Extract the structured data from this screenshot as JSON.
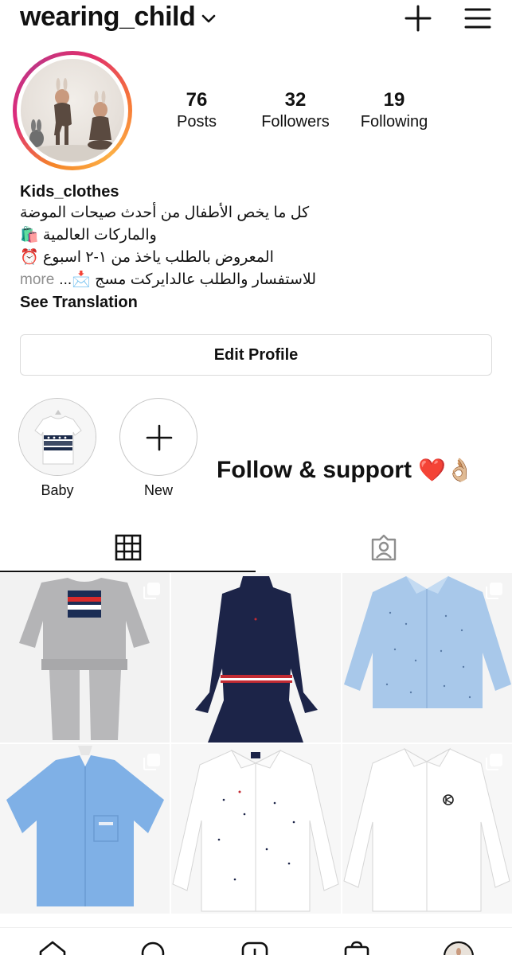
{
  "header": {
    "username": "wearing_child"
  },
  "stats": [
    {
      "value": "76",
      "label": "Posts"
    },
    {
      "value": "32",
      "label": "Followers"
    },
    {
      "value": "19",
      "label": "Following"
    }
  ],
  "bio": {
    "name": "Kids_clothes",
    "line1": "كل ما يخص الأطفال من أحدث صيحات الموضة",
    "line2": "والماركات العالمية 🛍️",
    "line3": "المعروض بالطلب ياخذ من ١-٢ اسبوع ⏰",
    "line4": "للاستفسار والطلب عالدايركت مسج 📩...",
    "more": "more",
    "see_translation": "See Translation"
  },
  "edit_profile_label": "Edit Profile",
  "highlights": [
    {
      "label": "Baby"
    },
    {
      "label": "New"
    }
  ],
  "overlay_text": "Follow & support",
  "overlay_emoji": "❤️👌🏼",
  "icons": {
    "top": [
      "chevron-down-icon",
      "plus-icon",
      "hamburger-menu-icon"
    ],
    "tabs": [
      "grid-icon",
      "tagged-person-icon"
    ],
    "nav": [
      "home-icon",
      "search-icon",
      "add-post-icon",
      "shop-icon",
      "profile-avatar-icon"
    ],
    "post_badge": "multiple-posts-icon"
  },
  "colors": {
    "text": "#111111",
    "muted": "#8e8e8e",
    "border": "#dbdbdb",
    "story_ring_start": "#f58529",
    "story_ring_end": "#dd2a7b"
  }
}
